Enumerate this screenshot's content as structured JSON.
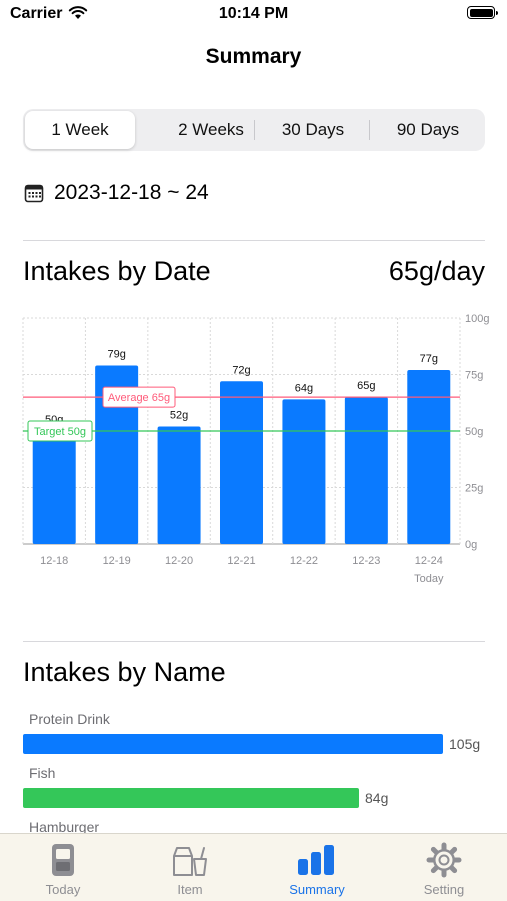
{
  "status_bar": {
    "carrier": "Carrier",
    "time": "10:14 PM"
  },
  "nav": {
    "title": "Summary"
  },
  "period_tabs": [
    {
      "label": "1 Week",
      "selected": true
    },
    {
      "label": "2 Weeks",
      "selected": false
    },
    {
      "label": "30 Days",
      "selected": false
    },
    {
      "label": "90 Days",
      "selected": false
    }
  ],
  "date_range": {
    "icon": "calendar-icon",
    "text": "2023-12-18 ~ 24"
  },
  "by_date": {
    "title": "Intakes by Date",
    "average_per_day": "65g/day"
  },
  "chart_data": {
    "type": "bar",
    "categories": [
      "12-18",
      "12-19",
      "12-20",
      "12-21",
      "12-22",
      "12-23",
      "12-24"
    ],
    "category_sublabels": [
      "",
      "",
      "",
      "",
      "",
      "",
      "Today"
    ],
    "values": [
      50,
      79,
      52,
      72,
      64,
      65,
      77
    ],
    "data_labels": [
      "50g",
      "79g",
      "52g",
      "72g",
      "64g",
      "65g",
      "77g"
    ],
    "unit": "g",
    "ylim": [
      0,
      100
    ],
    "yticks": [
      "0g",
      "25g",
      "50g",
      "75g",
      "100g"
    ],
    "grid": true,
    "bar_color": "#0a7aff",
    "average": {
      "label": "Average 65g",
      "value": 65,
      "color": "#ff5b7a"
    },
    "target": {
      "label": "Target 50g",
      "value": 50,
      "color": "#34c759"
    }
  },
  "by_name": {
    "title": "Intakes by Name",
    "items": [
      {
        "name": "Protein Drink",
        "value": 105,
        "label": "105g",
        "color": "#0a7aff"
      },
      {
        "name": "Fish",
        "value": 84,
        "label": "84g",
        "color": "#34c759"
      },
      {
        "name": "Hamburger",
        "value": null,
        "label": "",
        "color": ""
      }
    ]
  },
  "tab_bar": {
    "tabs": [
      {
        "label": "Today",
        "icon": "jar-icon",
        "active": false
      },
      {
        "label": "Item",
        "icon": "food-items-icon",
        "active": false
      },
      {
        "label": "Summary",
        "icon": "bar-chart-icon",
        "active": true
      },
      {
        "label": "Setting",
        "icon": "gear-icon",
        "active": false
      }
    ]
  },
  "colors": {
    "accent": "#1a73e8",
    "tab_bar_bg": "#f8f5ec"
  }
}
